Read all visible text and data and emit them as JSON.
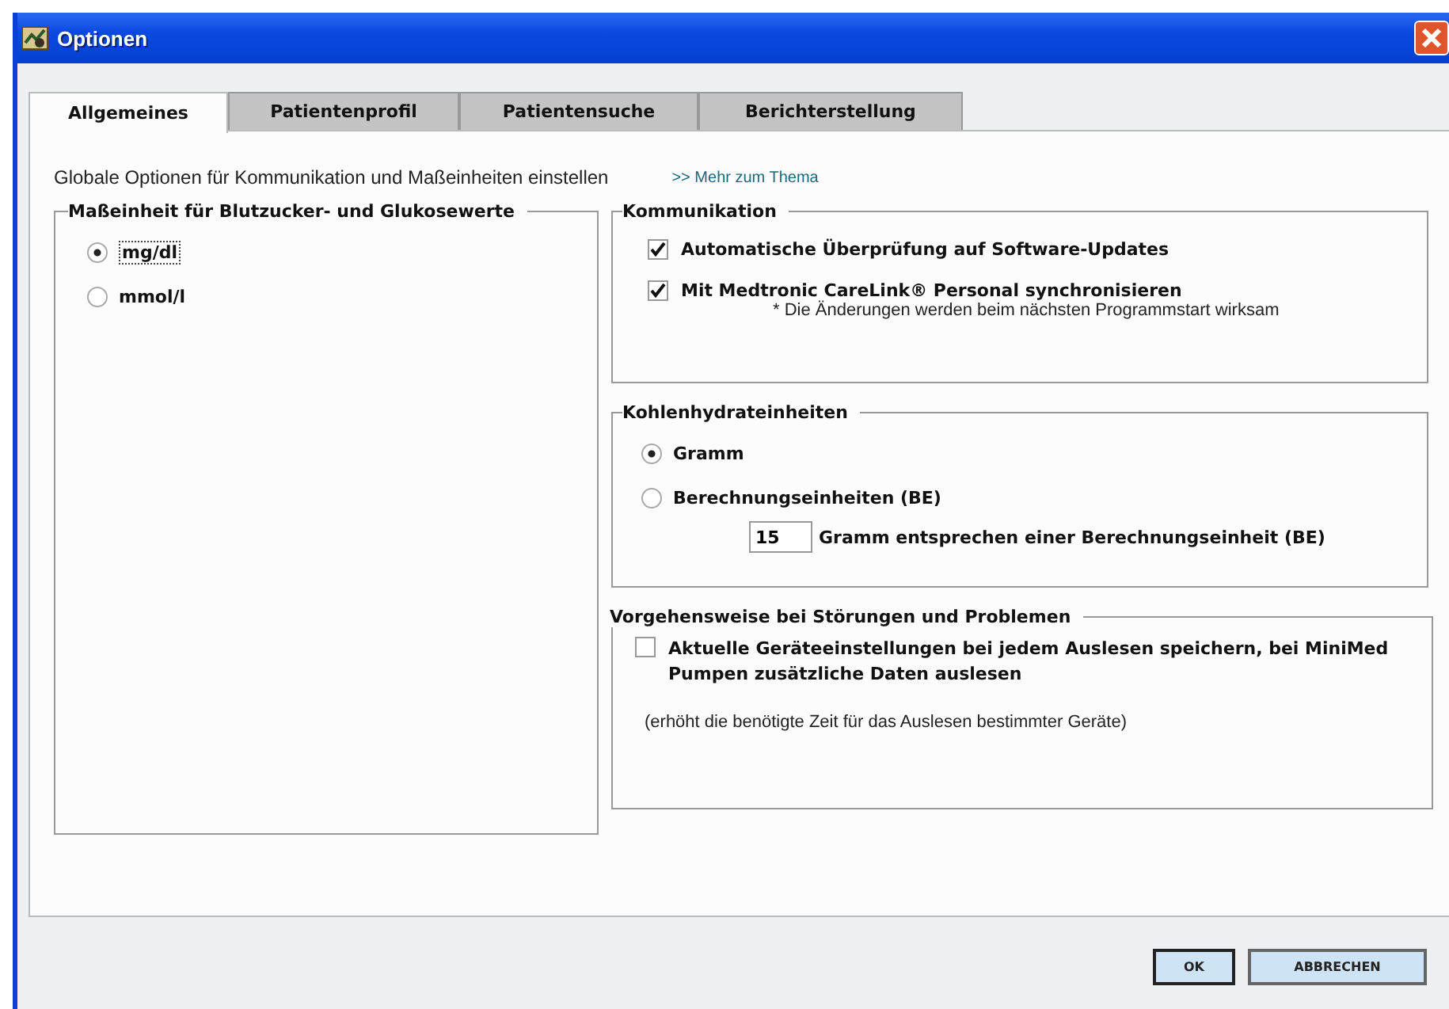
{
  "window": {
    "title": "Optionen"
  },
  "tabs": [
    {
      "label": "Allgemeines",
      "selected": true
    },
    {
      "label": "Patientenprofil",
      "selected": false
    },
    {
      "label": "Patientensuche",
      "selected": false
    },
    {
      "label": "Berichterstellung",
      "selected": false
    }
  ],
  "intro": "Globale Optionen für Kommunikation und Maßeinheiten einstellen",
  "more_link": ">> Mehr zum Thema",
  "units": {
    "title": "Maßeinheit für Blutzucker- und Glukosewerte",
    "options": [
      {
        "label": "mg/dl",
        "selected": true
      },
      {
        "label": "mmol/l",
        "selected": false
      }
    ]
  },
  "communication": {
    "title": "Kommunikation",
    "checkboxes": [
      {
        "label": "Automatische Überprüfung auf Software-Updates",
        "checked": true
      },
      {
        "label": "Mit Medtronic CareLink® Personal synchronisieren",
        "checked": true
      }
    ],
    "note": "* Die Änderungen werden beim nächsten Programmstart wirksam"
  },
  "carbs": {
    "title": "Kohlenhydrateinheiten",
    "options": [
      {
        "label": "Gramm",
        "selected": true
      },
      {
        "label": "Berechnungseinheiten (BE)",
        "selected": false
      }
    ],
    "amount": {
      "value": "15",
      "label": "Gramm entsprechen einer Berechnungseinheit (BE)"
    }
  },
  "troubleshooting": {
    "title": "Vorgehensweise bei Störungen und Problemen",
    "checkbox": {
      "label": "Aktuelle Geräteeinstellungen bei jedem Auslesen speichern, bei MiniMed Pumpen zusätzliche Daten auslesen",
      "checked": false
    },
    "note": "(erhöht die benötigte Zeit für das Auslesen bestimmter Geräte)"
  },
  "buttons": [
    {
      "label": "OK",
      "default": true
    },
    {
      "label": "ABBRECHEN",
      "default": false
    }
  ]
}
